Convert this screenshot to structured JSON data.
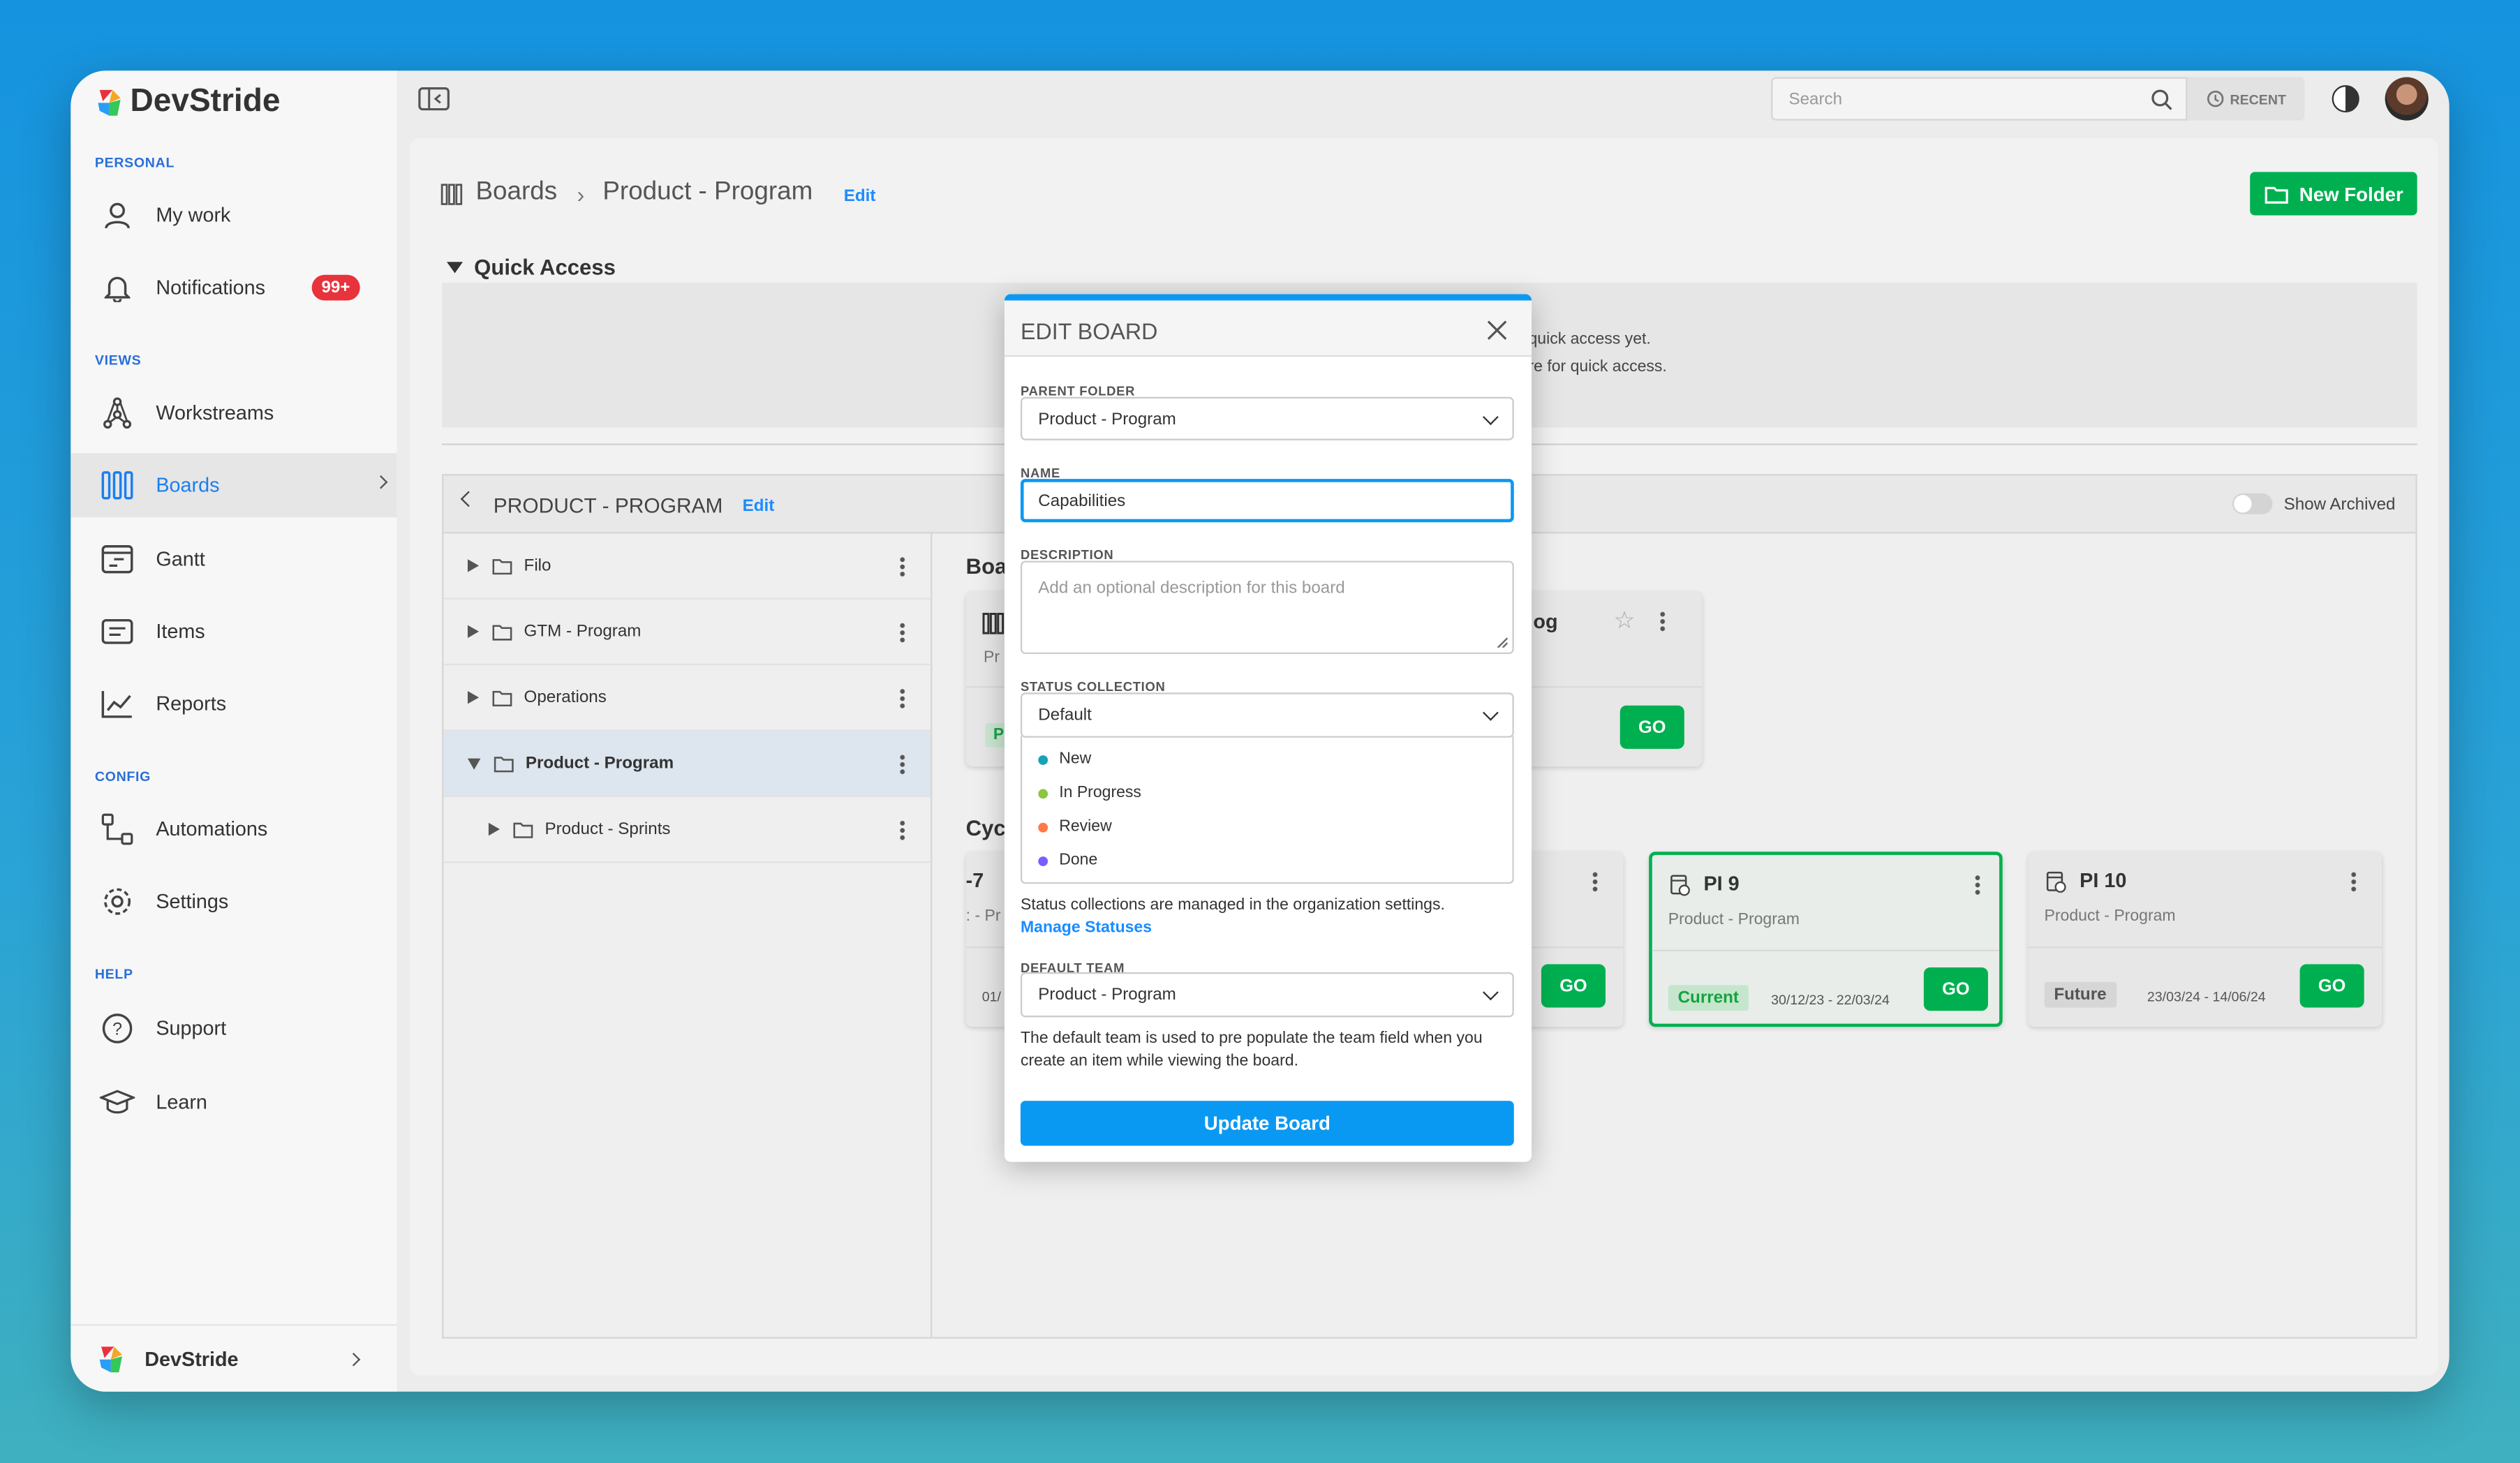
{
  "app": {
    "logo": "DevStride"
  },
  "sidebar": {
    "sections": {
      "personal": "PERSONAL",
      "views": "VIEWS",
      "config": "CONFIG",
      "help": "HELP"
    },
    "items": [
      {
        "label": "My work",
        "icon": "user-icon"
      },
      {
        "label": "Notifications",
        "icon": "bell-icon",
        "badge": "99+"
      },
      {
        "label": "Workstreams",
        "icon": "workstreams-icon"
      },
      {
        "label": "Boards",
        "icon": "boards-icon",
        "active": true
      },
      {
        "label": "Gantt",
        "icon": "gantt-icon"
      },
      {
        "label": "Items",
        "icon": "items-icon"
      },
      {
        "label": "Reports",
        "icon": "chart-icon"
      },
      {
        "label": "Automations",
        "icon": "automation-icon"
      },
      {
        "label": "Settings",
        "icon": "gear-icon"
      },
      {
        "label": "Support",
        "icon": "help-icon"
      },
      {
        "label": "Learn",
        "icon": "graduation-cap-icon"
      }
    ],
    "footer": "DevStride"
  },
  "topbar": {
    "search_placeholder": "Search",
    "recent": "RECENT"
  },
  "breadcrumb": {
    "root": "Boards",
    "current": "Product - Program",
    "edit": "Edit"
  },
  "new_folder": "New Folder",
  "quick_access": {
    "title": "Quick Access",
    "line1": "quick access yet.",
    "line2": "re for quick access."
  },
  "folder": {
    "title": "PRODUCT - PROGRAM",
    "edit": "Edit",
    "show_archived": "Show Archived",
    "tree": [
      "Filo",
      "GTM - Program",
      "Operations",
      "Product - Program",
      "Product - Sprints"
    ]
  },
  "boards_section": {
    "title": "Boa",
    "card": {
      "title": "og",
      "sub": "Pr",
      "badge": "P",
      "go": "GO"
    }
  },
  "cycles_section": {
    "title": "Cyc",
    "cards": [
      {
        "title": "-7",
        "sub": ": - Pr",
        "dates": "01/",
        "go": "GO"
      },
      {
        "title": "PI 9",
        "sub": "Product - Program",
        "status": "Current",
        "dates": "30/12/23 - 22/03/24",
        "go": "GO"
      },
      {
        "title": "PI 10",
        "sub": "Product - Program",
        "status": "Future",
        "dates": "23/03/24 - 14/06/24",
        "go": "GO"
      }
    ]
  },
  "modal": {
    "title": "EDIT BOARD",
    "parent_label": "PARENT FOLDER",
    "parent_value": "Product - Program",
    "name_label": "NAME",
    "name_value": "Capabilities",
    "desc_label": "DESCRIPTION",
    "desc_placeholder": "Add an optional description for this board",
    "status_label": "STATUS COLLECTION",
    "status_value": "Default",
    "statuses": [
      {
        "name": "New",
        "color": "#17a2b8"
      },
      {
        "name": "In Progress",
        "color": "#8cc63f"
      },
      {
        "name": "Review",
        "color": "#ff7a45"
      },
      {
        "name": "Done",
        "color": "#7b5cff"
      }
    ],
    "status_note": "Status collections are managed in the organization settings.",
    "manage_link": "Manage Statuses",
    "team_label": "DEFAULT TEAM",
    "team_value": "Product - Program",
    "team_note": "The default team is used to pre populate the team field when you create an item while viewing the board.",
    "submit": "Update Board"
  },
  "colors": {
    "accent": "#0a99f2",
    "green": "#00b050",
    "badge": "#e8323c"
  }
}
